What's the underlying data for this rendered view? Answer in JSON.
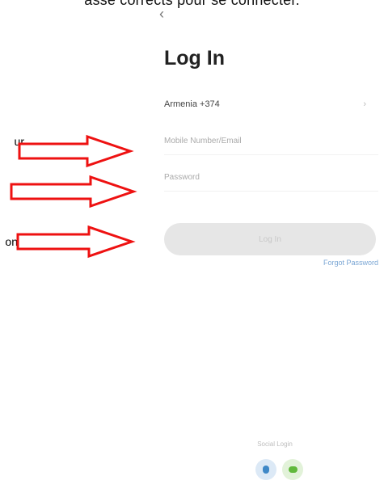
{
  "document": {
    "top_text": "asse  corrects pour se connecter.",
    "annotation_1": "ur",
    "annotation_3": "on"
  },
  "login": {
    "title": "Log In",
    "region": "Armenia +374",
    "phone_email_placeholder": "Mobile Number/Email",
    "password_placeholder": "Password",
    "login_button": "Log In",
    "forgot_password": "Forgot Password",
    "social_login_label": "Social Login"
  },
  "arrows": {
    "color": "#ee1111",
    "stroke": "#d40000"
  },
  "icons": {
    "back": "back-chevron-icon",
    "region_dropdown": "chevron-right-icon",
    "social_1": "account-icon",
    "social_2": "wechat-icon"
  }
}
